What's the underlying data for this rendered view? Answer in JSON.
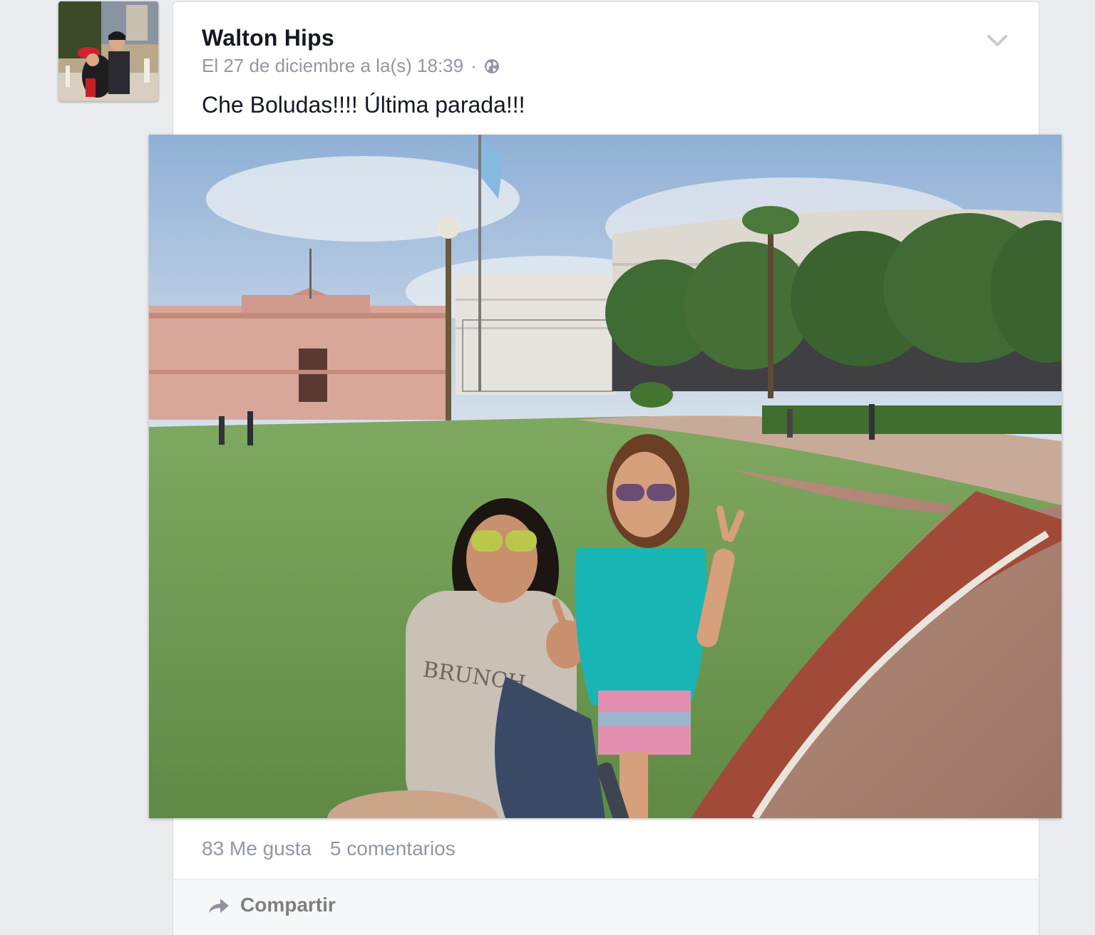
{
  "post": {
    "author": "Walton Hips",
    "timestamp": "El 27 de diciembre a la(s) 18:39",
    "separator": "·",
    "privacy_icon": "globe-icon",
    "menu_icon": "chevron-down-icon",
    "text": "Che Boludas!!!! Última parada!!!",
    "photo_shirt_text": "BRUNCH"
  },
  "stats": {
    "likes": "83 Me gusta",
    "comments": "5 comentarios"
  },
  "actions": {
    "share_label": "Compartir",
    "share_icon": "share-arrow-icon"
  },
  "colors": {
    "background": "#e9ebee",
    "name": "#141823",
    "muted": "#9197a3",
    "action_bar": "#f6f7f9"
  }
}
